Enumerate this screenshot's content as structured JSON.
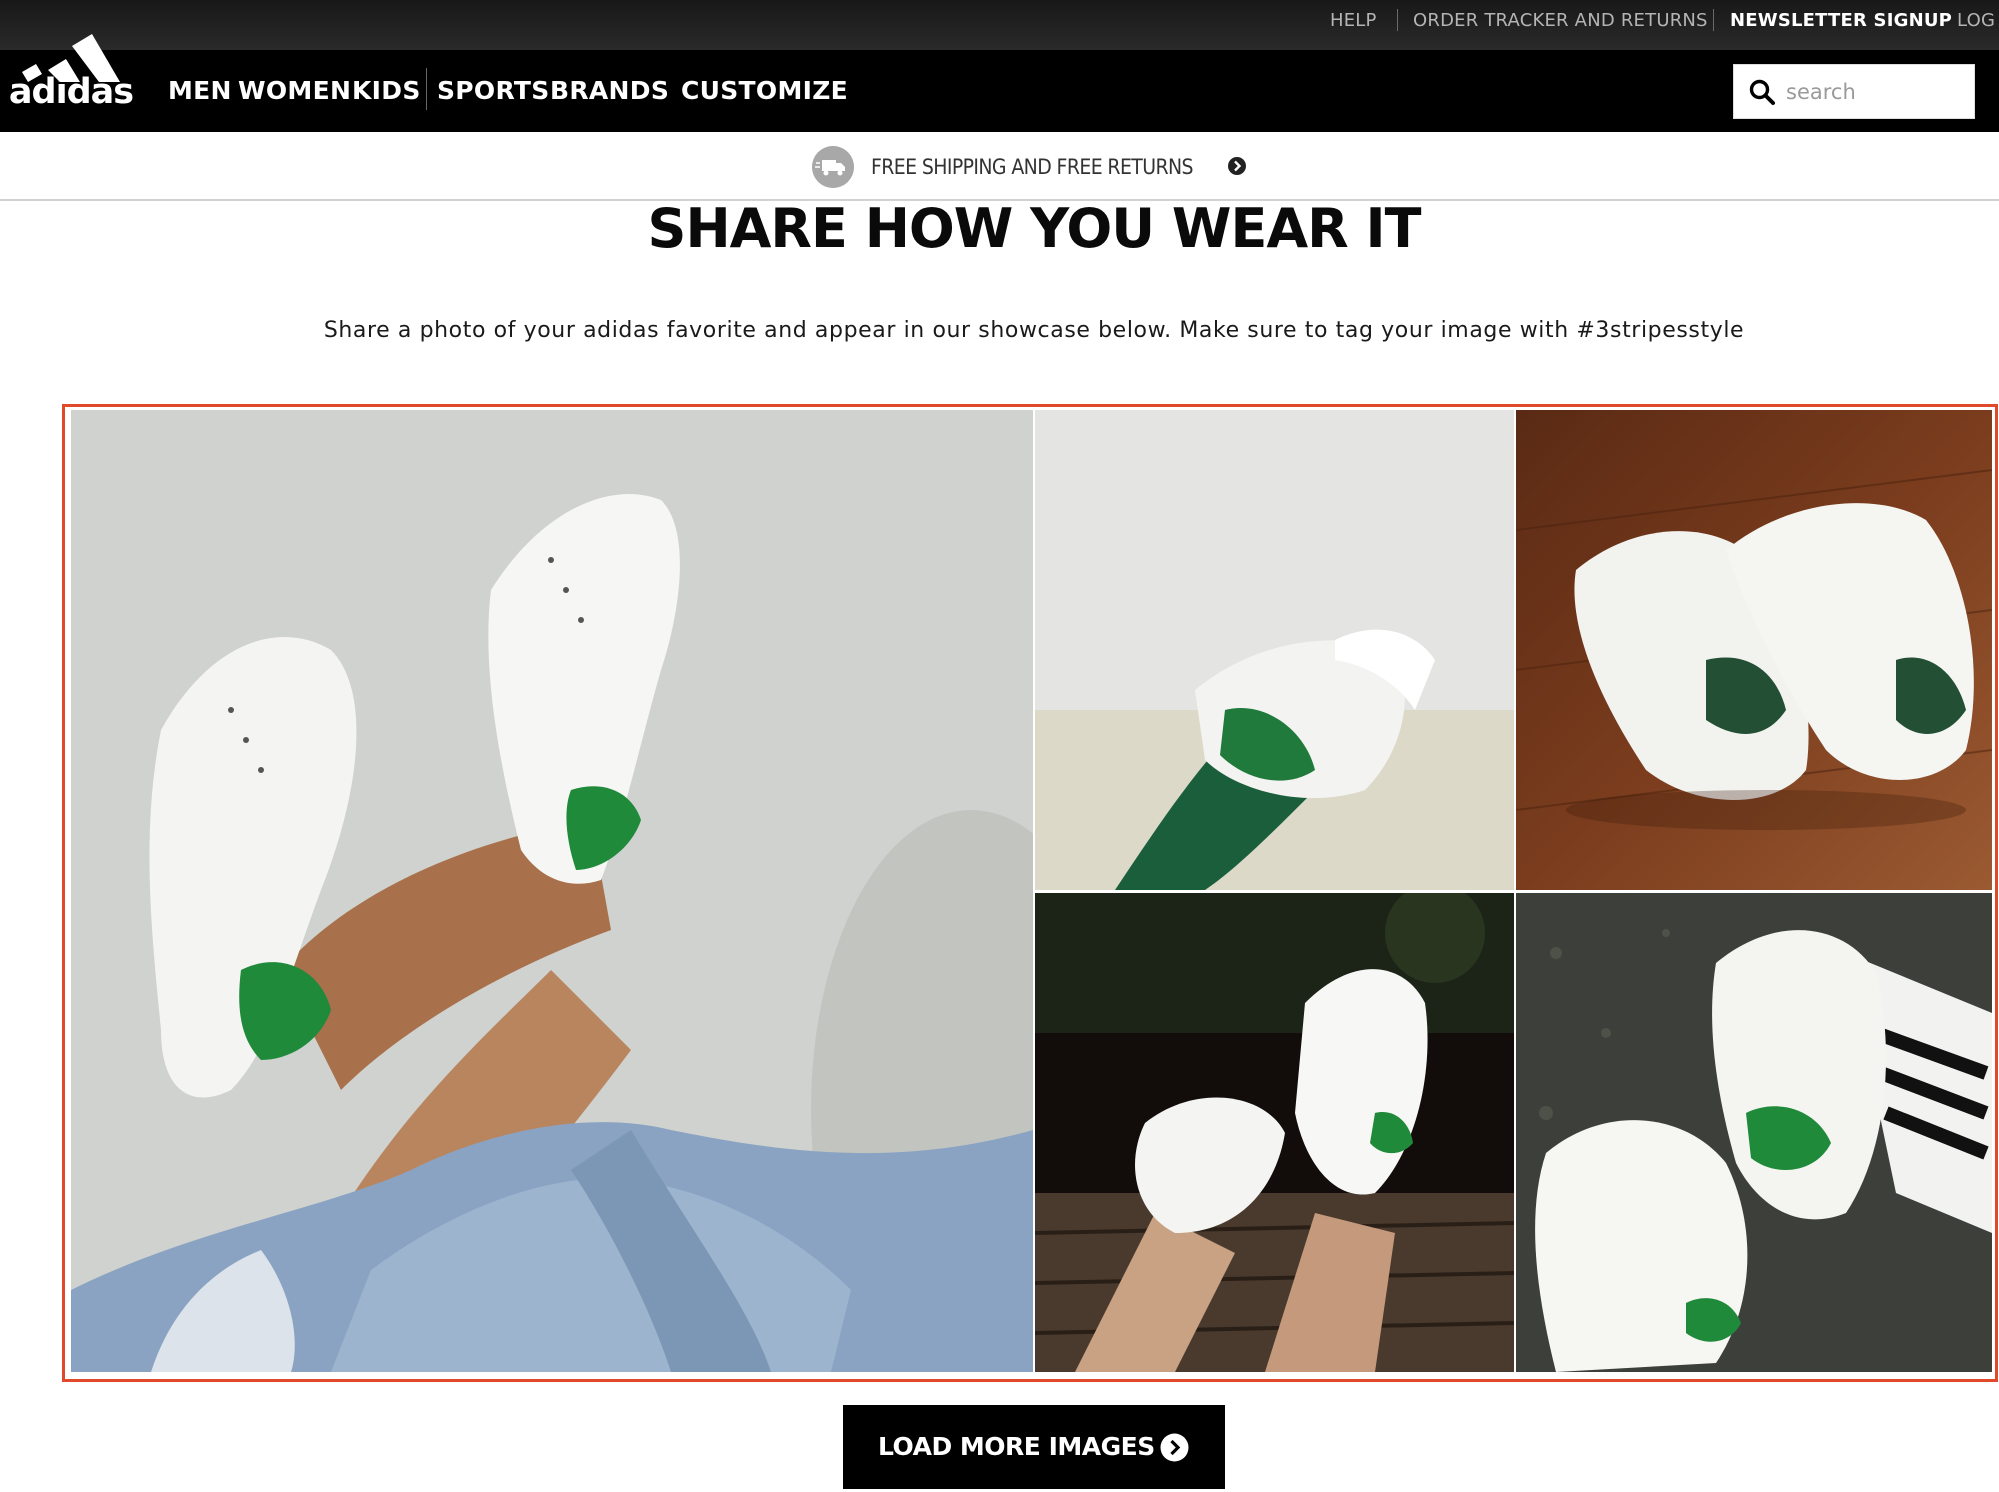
{
  "utility_nav": {
    "items": [
      {
        "label": "HELP"
      },
      {
        "label": "ORDER TRACKER AND RETURNS"
      },
      {
        "label": "NEWSLETTER SIGNUP"
      },
      {
        "label": "LOG I"
      }
    ]
  },
  "brand": {
    "logo_text": "adidas"
  },
  "main_nav": {
    "items": [
      {
        "label": "MEN"
      },
      {
        "label": "WOMEN"
      },
      {
        "label": "KIDS"
      },
      {
        "label": "SPORTS"
      },
      {
        "label": "BRANDS"
      },
      {
        "label": "CUSTOMIZE"
      }
    ]
  },
  "search": {
    "placeholder": "search",
    "value": ""
  },
  "promo": {
    "text": "FREE SHIPPING AND FREE RETURNS"
  },
  "content": {
    "title": "SHARE HOW YOU WEAR IT",
    "intro": "Share a photo of your adidas favorite and appear in our showcase below. Make sure to tag your image with #3stripesstyle"
  },
  "gallery": {
    "highlight_color": "#e04a2a",
    "tiles": [
      {
        "subject": "legs crossed against wall wearing white green-heel sneakers"
      },
      {
        "subject": "green sock with white sneaker heel"
      },
      {
        "subject": "pair of sneakers on wood floor"
      },
      {
        "subject": "feet up with sneakers over deck"
      },
      {
        "subject": "sneakers with striped socks on asphalt"
      }
    ]
  },
  "load_more": {
    "label": "LOAD MORE IMAGES"
  },
  "colors": {
    "nav_bg": "#000000",
    "accent_green": "#1a7a32",
    "text": "#000000"
  }
}
